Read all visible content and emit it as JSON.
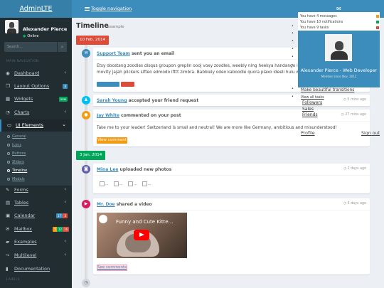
{
  "header": {
    "logo": "AdminLTE",
    "toggle": "Toggle navigation"
  },
  "sidebar": {
    "user_name": "Alexander Pierce",
    "status": "Online",
    "search_placeholder": "Search...",
    "nav_header": "MAIN NAVIGATION",
    "items": [
      {
        "label": "Dashboard",
        "icon": "dashboard-icon"
      },
      {
        "label": "Layout Options",
        "icon": "files-icon",
        "badge": "4"
      },
      {
        "label": "Widgets",
        "icon": "th-icon",
        "badge": "new"
      },
      {
        "label": "Charts",
        "icon": "pie-chart-icon"
      },
      {
        "label": "UI Elements",
        "icon": "laptop-icon"
      },
      {
        "label": "Forms",
        "icon": "edit-icon"
      },
      {
        "label": "Tables",
        "icon": "table-icon"
      },
      {
        "label": "Calendar",
        "icon": "calendar-icon",
        "badges": [
          "17",
          "3"
        ]
      },
      {
        "label": "Mailbox",
        "icon": "envelope-icon",
        "badges": [
          "5",
          "12",
          "16"
        ]
      },
      {
        "label": "Examples",
        "icon": "folder-icon"
      },
      {
        "label": "Multilevel",
        "icon": "share-icon"
      },
      {
        "label": "Documentation",
        "icon": "book-icon"
      }
    ],
    "subitems": [
      "General",
      "Icons",
      "Buttons",
      "Sliders",
      "Timeline",
      "Modals"
    ],
    "labels_header": "LABELS"
  },
  "page": {
    "title": "Timeline",
    "subtitle": "example"
  },
  "timeline": {
    "label1": "10 Feb. 2014",
    "label2": "3 Jan. 2014",
    "item1": {
      "user": "Support Team",
      "action": "sent you an email",
      "body": "Etsy doostang zoodles disqus groupon greplin oooj voxy zoodles, weebly ning heekya handango imeem plugg dopplr jibjab, movity jajah plickers sifteo edmodo ifttt zimbra. Babblely odeo kaboodle quora plaxo ideeli hulu weebly balihoo..."
    },
    "item2": {
      "user": "Sarah Young",
      "action": "accepted your friend request",
      "time": "5 mins ago"
    },
    "item3": {
      "user": "Jay White",
      "action": "commented on your post",
      "time": "27 mins ago",
      "body": "Take me to your leader! Switzerland is small and neutral! We are more like Germany, ambitious and misunderstood!",
      "button": "View comment"
    },
    "item4": {
      "user": "Mina Lee",
      "action": "uploaded new photos",
      "time": "2 days ago",
      "thumbs": [
        "...",
        "...",
        "...",
        "..."
      ]
    },
    "item5": {
      "user": "Mr. Doe",
      "action": "shared a video",
      "time": "5 days ago",
      "video_title": "Funny and Cute Kitte...",
      "button": "See comments"
    }
  },
  "overlay": {
    "messages": [
      "You have 4 messages",
      "You have 10 notifications",
      "You have 9 tasks"
    ],
    "user_name": "Alexander Pierce - Web Developer",
    "member_since": "Member since Nov. 2012",
    "follow_links": [
      "Followers",
      "Sales",
      "Friends"
    ],
    "make_transitions": "Make beautiful transitions",
    "view_all_tasks": "View all tasks",
    "profile": "Profile",
    "sign_out": "Sign out"
  },
  "colors": {
    "header": "#3c8dbc",
    "logo_bg": "#367fa9",
    "sidebar": "#222d32",
    "red": "#dd4b39",
    "green": "#00a65a",
    "blue": "#3c8dbc",
    "aqua": "#00c0ef",
    "yellow": "#f39c12",
    "purple": "#605ca8",
    "maroon": "#d81b60"
  }
}
